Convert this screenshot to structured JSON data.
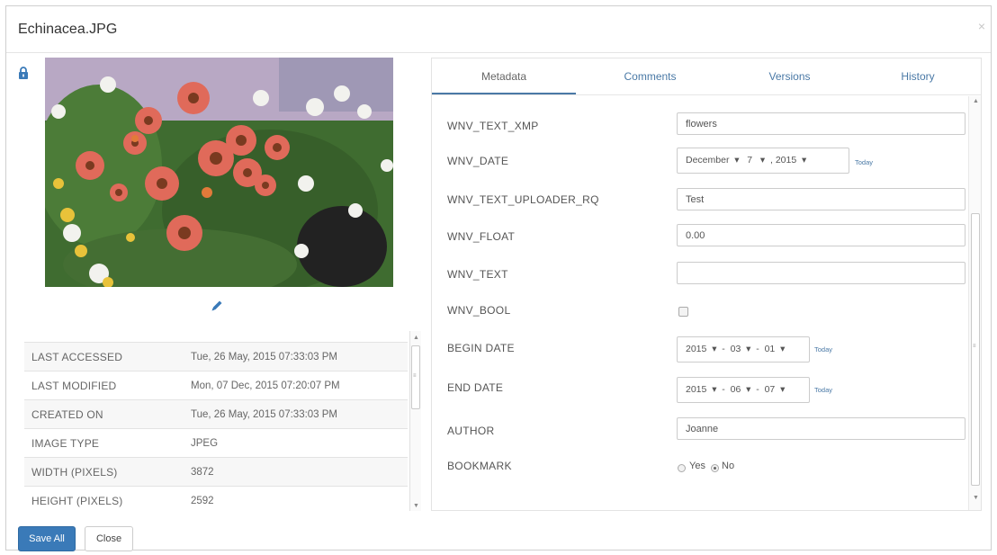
{
  "modal": {
    "title": "Echinacea.JPG",
    "close": "×"
  },
  "image": {
    "subject": "echinacea-flowers-photo"
  },
  "info_rows": [
    {
      "label": "LAST ACCESSED",
      "value": "Tue, 26 May, 2015 07:33:03 PM"
    },
    {
      "label": "LAST MODIFIED",
      "value": "Mon, 07 Dec, 2015 07:20:07 PM"
    },
    {
      "label": "CREATED ON",
      "value": "Tue, 26 May, 2015 07:33:03 PM"
    },
    {
      "label": "IMAGE TYPE",
      "value": "JPEG"
    },
    {
      "label": "WIDTH (PIXELS)",
      "value": "3872"
    },
    {
      "label": "HEIGHT (PIXELS)",
      "value": "2592"
    }
  ],
  "tabs": [
    "Metadata",
    "Comments",
    "Versions",
    "History"
  ],
  "active_tab": "Metadata",
  "fields": {
    "text_xmp": {
      "label": "WNV_TEXT_XMP",
      "value": "flowers"
    },
    "date": {
      "label": "WNV_DATE",
      "display": "December  ▾   7   ▾  , 2015  ▾",
      "today": "Today"
    },
    "uploader": {
      "label": "WNV_TEXT_UPLOADER_RQ",
      "value": "Test"
    },
    "float": {
      "label": "WNV_FLOAT",
      "value": "0.00"
    },
    "text": {
      "label": "WNV_TEXT",
      "value": ""
    },
    "bool": {
      "label": "WNV_BOOL"
    },
    "begin_date": {
      "label": "BEGIN DATE",
      "display": "2015  ▾  -  03  ▾  -  01  ▾",
      "today": "Today"
    },
    "end_date": {
      "label": "END DATE",
      "display": "2015  ▾  -  06  ▾  -  07  ▾",
      "today": "Today"
    },
    "author": {
      "label": "AUTHOR",
      "value": "Joanne"
    },
    "bookmark": {
      "label": "BOOKMARK",
      "yes": "Yes",
      "no": "No",
      "selected": "No"
    }
  },
  "buttons": {
    "save_all": "Save All",
    "close": "Close"
  },
  "colors": {
    "primary": "#3a7ab8",
    "link": "#4a79a6"
  }
}
